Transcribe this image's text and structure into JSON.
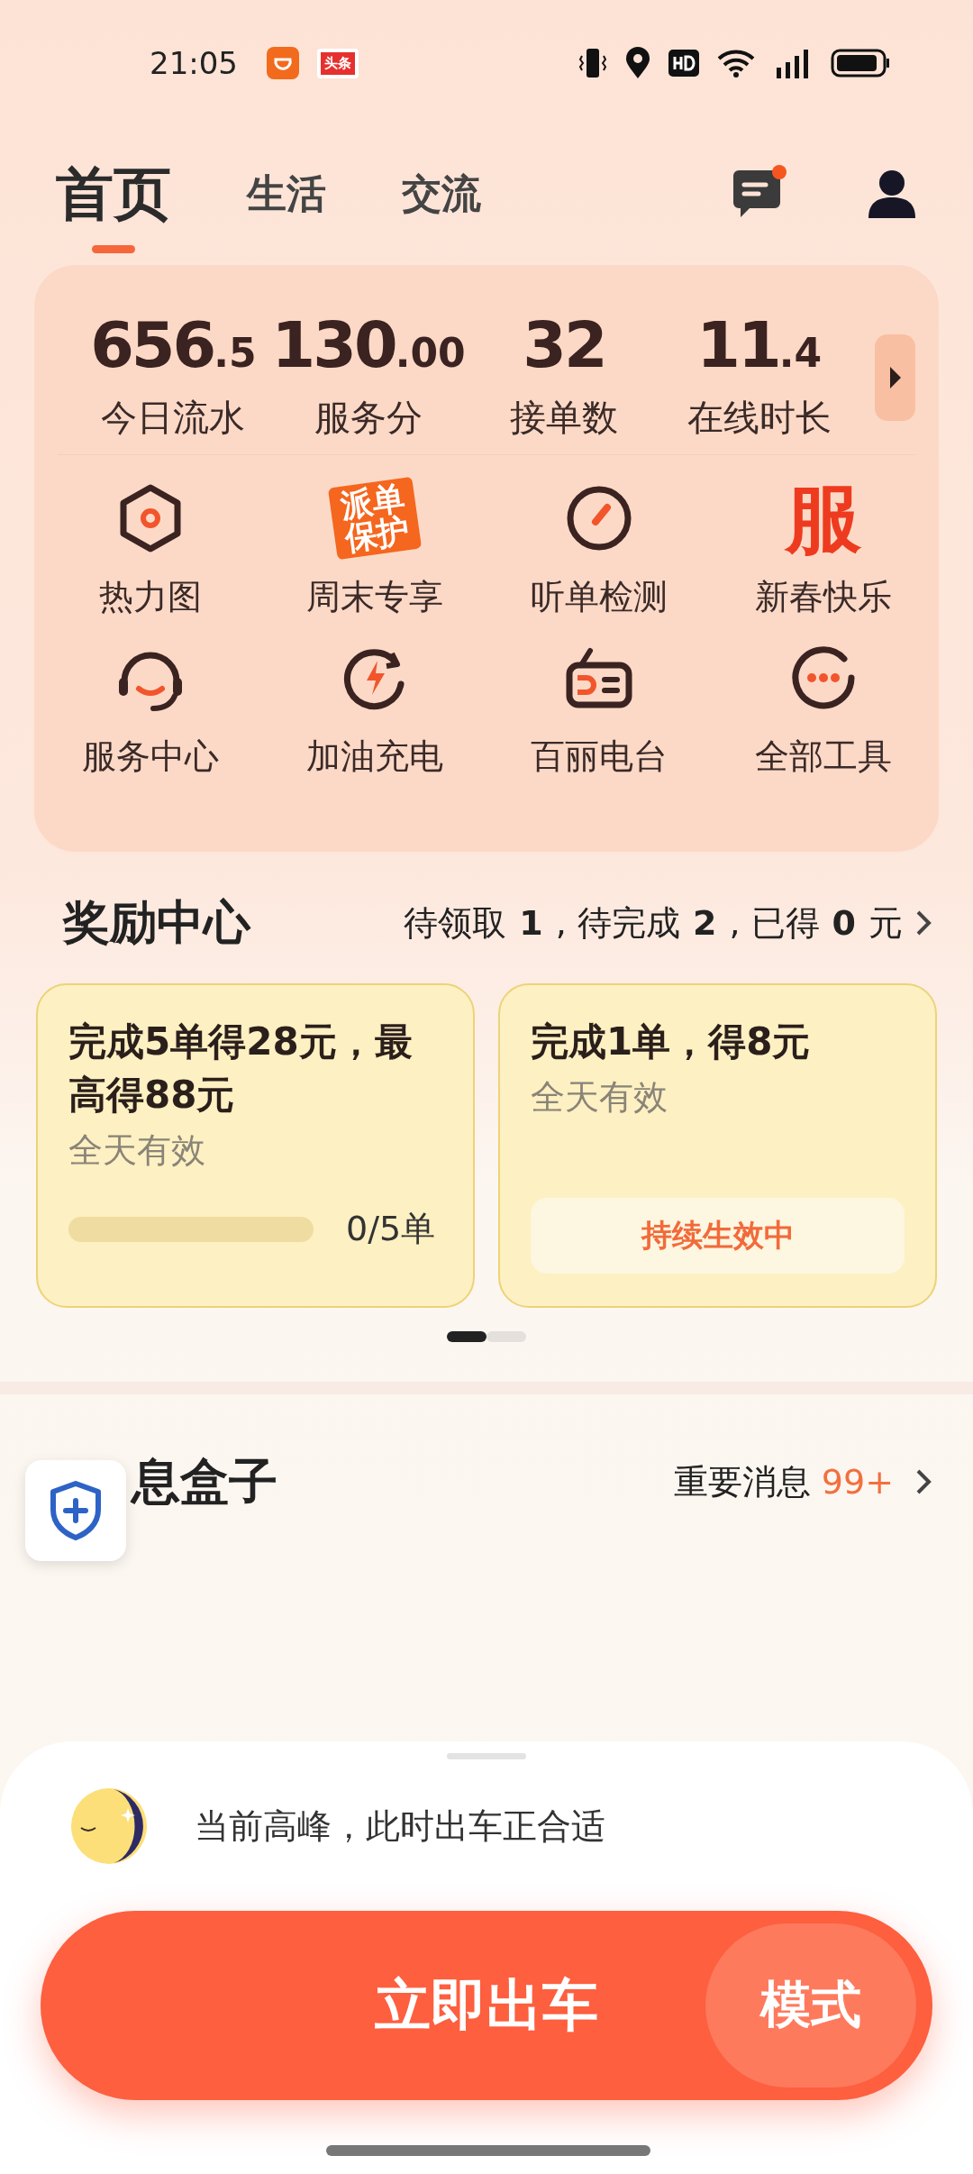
{
  "status_bar": {
    "time": "21:05",
    "notification_badge": "头条"
  },
  "tabs": [
    {
      "label": "首页",
      "selected": true
    },
    {
      "label": "生活",
      "selected": false
    },
    {
      "label": "交流",
      "selected": false
    }
  ],
  "header": {
    "messages_unread": true
  },
  "stats": [
    {
      "value": "656",
      "decimal": ".5",
      "label": "今日流水"
    },
    {
      "value": "130",
      "decimal": ".00",
      "label": "服务分"
    },
    {
      "value": "32",
      "label": "接单数"
    },
    {
      "value": "11",
      "decimal": ".4",
      "label": "在线时长"
    }
  ],
  "tools": [
    {
      "kind": "hexagon",
      "label": "热力图"
    },
    {
      "kind": "badge_text",
      "badge": "派单保护",
      "label": "周末专享"
    },
    {
      "kind": "gauge",
      "label": "听单检测"
    },
    {
      "kind": "big_char",
      "badge": "服",
      "label": "新春快乐"
    },
    {
      "kind": "headset",
      "label": "服务中心"
    },
    {
      "kind": "charge",
      "label": "加油充电"
    },
    {
      "kind": "radio",
      "label": "百丽电台"
    },
    {
      "kind": "more",
      "label": "全部工具"
    }
  ],
  "rewards": {
    "title": "奖励中心",
    "summary": "待领取**1**, 待完成**2**, 已得**0**元",
    "cards": [
      {
        "kind": "progress",
        "title": "完成5单得**28**元，最高得**88**元",
        "subtitle": "全天有效",
        "level": 0,
        "progress_text": "0/5单"
      },
      {
        "kind": "status",
        "title": "完成1单，得**8**元",
        "subtitle": "全天有效",
        "status": "持续生效中"
      }
    ],
    "pages": [
      {
        "selected": true
      },
      {
        "selected": false
      }
    ]
  },
  "message_box": {
    "title": "息盒子",
    "link": "重要消息",
    "count": "99+"
  },
  "bottom": {
    "tip": "当前高峰，此时出车正合适",
    "go_button": "立即出车",
    "mode_button": "模式"
  }
}
